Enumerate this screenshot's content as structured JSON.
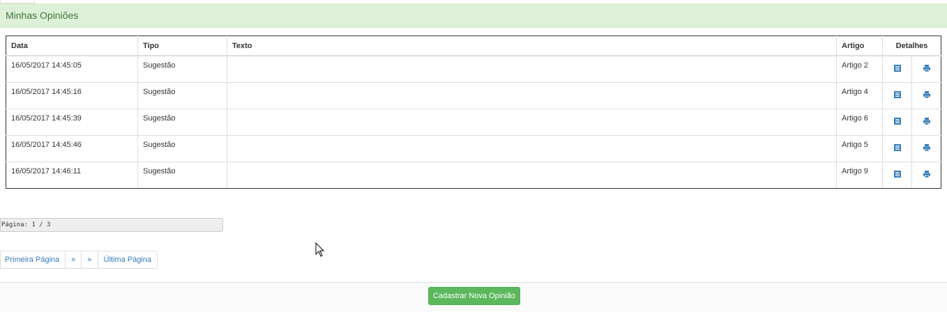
{
  "panel": {
    "title": "Minhas Opiniões"
  },
  "table": {
    "headers": {
      "data": "Data",
      "tipo": "Tipo",
      "texto": "Texto",
      "artigo": "Artigo",
      "detalhes": "Detalhes"
    },
    "rows": [
      {
        "data": "16/05/2017 14:45:05",
        "tipo": "Sugestão",
        "texto": "",
        "artigo": "Artigo 2"
      },
      {
        "data": "16/05/2017 14:45:16",
        "tipo": "Sugestão",
        "texto": "",
        "artigo": "Artigo 4"
      },
      {
        "data": "16/05/2017 14:45:39",
        "tipo": "Sugestão",
        "texto": "",
        "artigo": "Artigo 6"
      },
      {
        "data": "16/05/2017 14:45:46",
        "tipo": "Sugestão",
        "texto": "",
        "artigo": "Artigo 5"
      },
      {
        "data": "16/05/2017 14:46:11",
        "tipo": "Sugestão",
        "texto": "",
        "artigo": "Artigo 9"
      }
    ],
    "icons": {
      "details": "list-icon",
      "print": "print-icon"
    }
  },
  "pager": {
    "info": "Página: 1 / 3",
    "first": "Primeira Página",
    "prev": "«",
    "next": "»",
    "last": "Última Página"
  },
  "footer": {
    "new_button": "Cadastrar Nova Opinião"
  },
  "colors": {
    "accent": "#337ab7",
    "heading_bg": "#dff0d8",
    "heading_text": "#3c763d",
    "button_bg": "#5cb85c"
  }
}
